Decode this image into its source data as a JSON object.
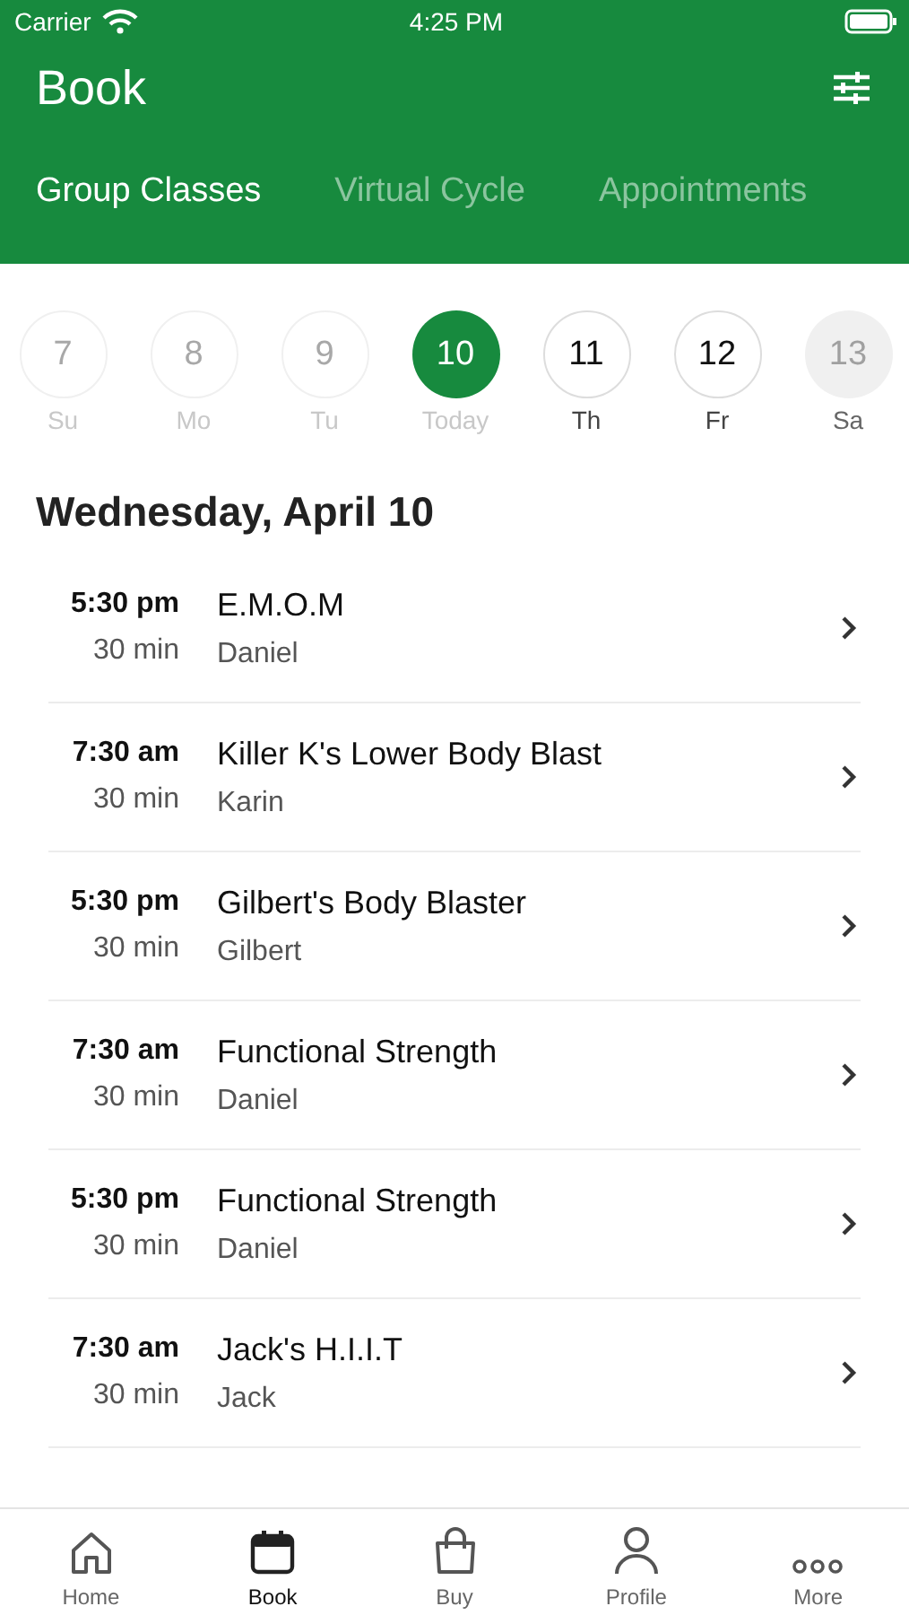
{
  "status_bar": {
    "carrier": "Carrier",
    "time": "4:25 PM"
  },
  "header": {
    "title": "Book"
  },
  "tabs": [
    {
      "label": "Group Classes",
      "selected": true
    },
    {
      "label": "Virtual Cycle",
      "selected": false
    },
    {
      "label": "Appointments",
      "selected": false
    }
  ],
  "days": [
    {
      "number": "7",
      "label": "Su",
      "kind": "past",
      "selected": false
    },
    {
      "number": "8",
      "label": "Mo",
      "kind": "past",
      "selected": false
    },
    {
      "number": "9",
      "label": "Tu",
      "kind": "past",
      "selected": false
    },
    {
      "number": "10",
      "label": "Today",
      "kind": "past",
      "selected": true
    },
    {
      "number": "11",
      "label": "Th",
      "kind": "open",
      "selected": false
    },
    {
      "number": "12",
      "label": "Fr",
      "kind": "open",
      "selected": false
    },
    {
      "number": "13",
      "label": "Sa",
      "kind": "closed",
      "selected": false
    }
  ],
  "date_heading": "Wednesday, April 10",
  "classes": [
    {
      "time": "5:30 pm",
      "duration": "30 min",
      "name": "E.M.O.M",
      "instructor": "Daniel"
    },
    {
      "time": "7:30 am",
      "duration": "30 min",
      "name": "Killer K's Lower Body Blast",
      "instructor": "Karin"
    },
    {
      "time": "5:30 pm",
      "duration": "30 min",
      "name": "Gilbert's Body Blaster",
      "instructor": "Gilbert"
    },
    {
      "time": "7:30 am",
      "duration": "30 min",
      "name": "Functional Strength",
      "instructor": "Daniel"
    },
    {
      "time": "5:30 pm",
      "duration": "30 min",
      "name": "Functional Strength",
      "instructor": "Daniel"
    },
    {
      "time": "7:30 am",
      "duration": "30 min",
      "name": "Jack's H.I.I.T",
      "instructor": "Jack"
    }
  ],
  "nav": [
    {
      "label": "Home",
      "selected": false
    },
    {
      "label": "Book",
      "selected": true
    },
    {
      "label": "Buy",
      "selected": false
    },
    {
      "label": "Profile",
      "selected": false
    },
    {
      "label": "More",
      "selected": false
    }
  ]
}
